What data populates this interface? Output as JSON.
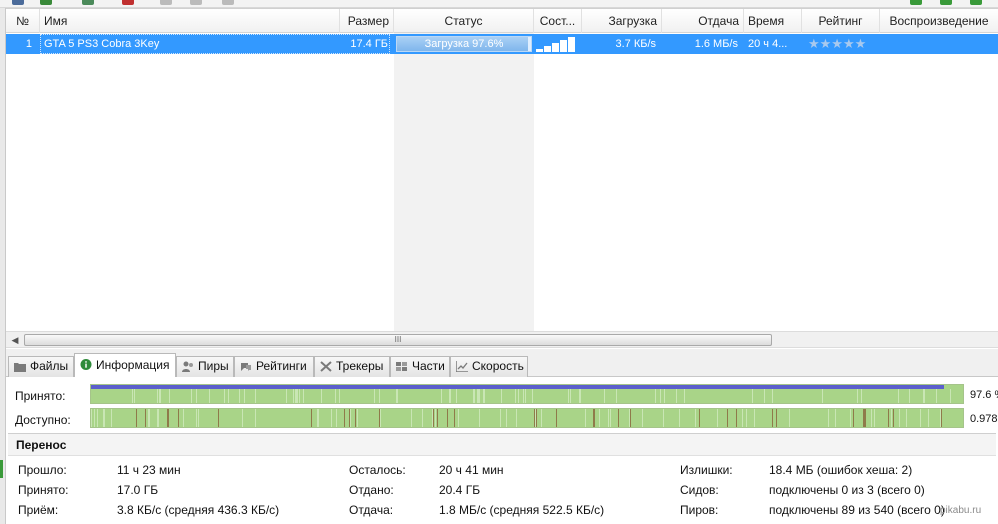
{
  "colors": {
    "selection": "#3399ff",
    "progress_available": "#a9d488",
    "progress_received_bar": "#5b5fcc"
  },
  "list": {
    "columns": [
      "№",
      "Имя",
      "Размер",
      "Статус",
      "Сост...",
      "Загрузка",
      "Отдача",
      "Время",
      "Рейтинг",
      "Воспроизведение"
    ],
    "rows": [
      {
        "num": "1",
        "name": "GTA 5 PS3 Cobra 3Key",
        "size": "17.4 ГБ",
        "status": "Загрузка 97.6%",
        "progress_fraction": 0.976,
        "health_bars": 5,
        "download": "3.7 КБ/s",
        "upload": "1.6 МБ/s",
        "time": "20 ч 4...",
        "rating": "★★★★★"
      }
    ]
  },
  "hscroll": {
    "grip": "III"
  },
  "tabs": [
    {
      "label": "Файлы",
      "icon": "files-icon"
    },
    {
      "label": "Информация",
      "icon": "info-icon",
      "active": true
    },
    {
      "label": "Пиры",
      "icon": "peers-icon"
    },
    {
      "label": "Рейтинги",
      "icon": "ratings-icon"
    },
    {
      "label": "Трекеры",
      "icon": "trackers-icon"
    },
    {
      "label": "Части",
      "icon": "pieces-icon"
    },
    {
      "label": "Скорость",
      "icon": "speed-icon"
    }
  ],
  "info": {
    "received_label": "Принято:",
    "received_value": "97.6 %",
    "available_label": "Доступно:",
    "available_value": "0.978",
    "section_title": "Перенос",
    "rows": [
      [
        {
          "k": "Прошло:",
          "v": "11 ч 23 мин"
        },
        {
          "k": "Осталось:",
          "v": "20 ч 41 мин"
        },
        {
          "k": "Излишки:",
          "v": "18.4 МБ (ошибок хеша: 2)"
        }
      ],
      [
        {
          "k": "Принято:",
          "v": "17.0 ГБ"
        },
        {
          "k": "Отдано:",
          "v": "20.4 ГБ"
        },
        {
          "k": "Сидов:",
          "v": "подключены 0 из 3 (всего 0)"
        }
      ],
      [
        {
          "k": "Приём:",
          "v": "3.8 КБ/с (средняя 436.3 КБ/с)"
        },
        {
          "k": "Отдача:",
          "v": "1.8 МБ/с (средняя 522.5 КБ/с)"
        },
        {
          "k": "Пиров:",
          "v": "подключены 89 из 540 (всего 0)"
        }
      ]
    ]
  },
  "watermark": "pikabu.ru"
}
